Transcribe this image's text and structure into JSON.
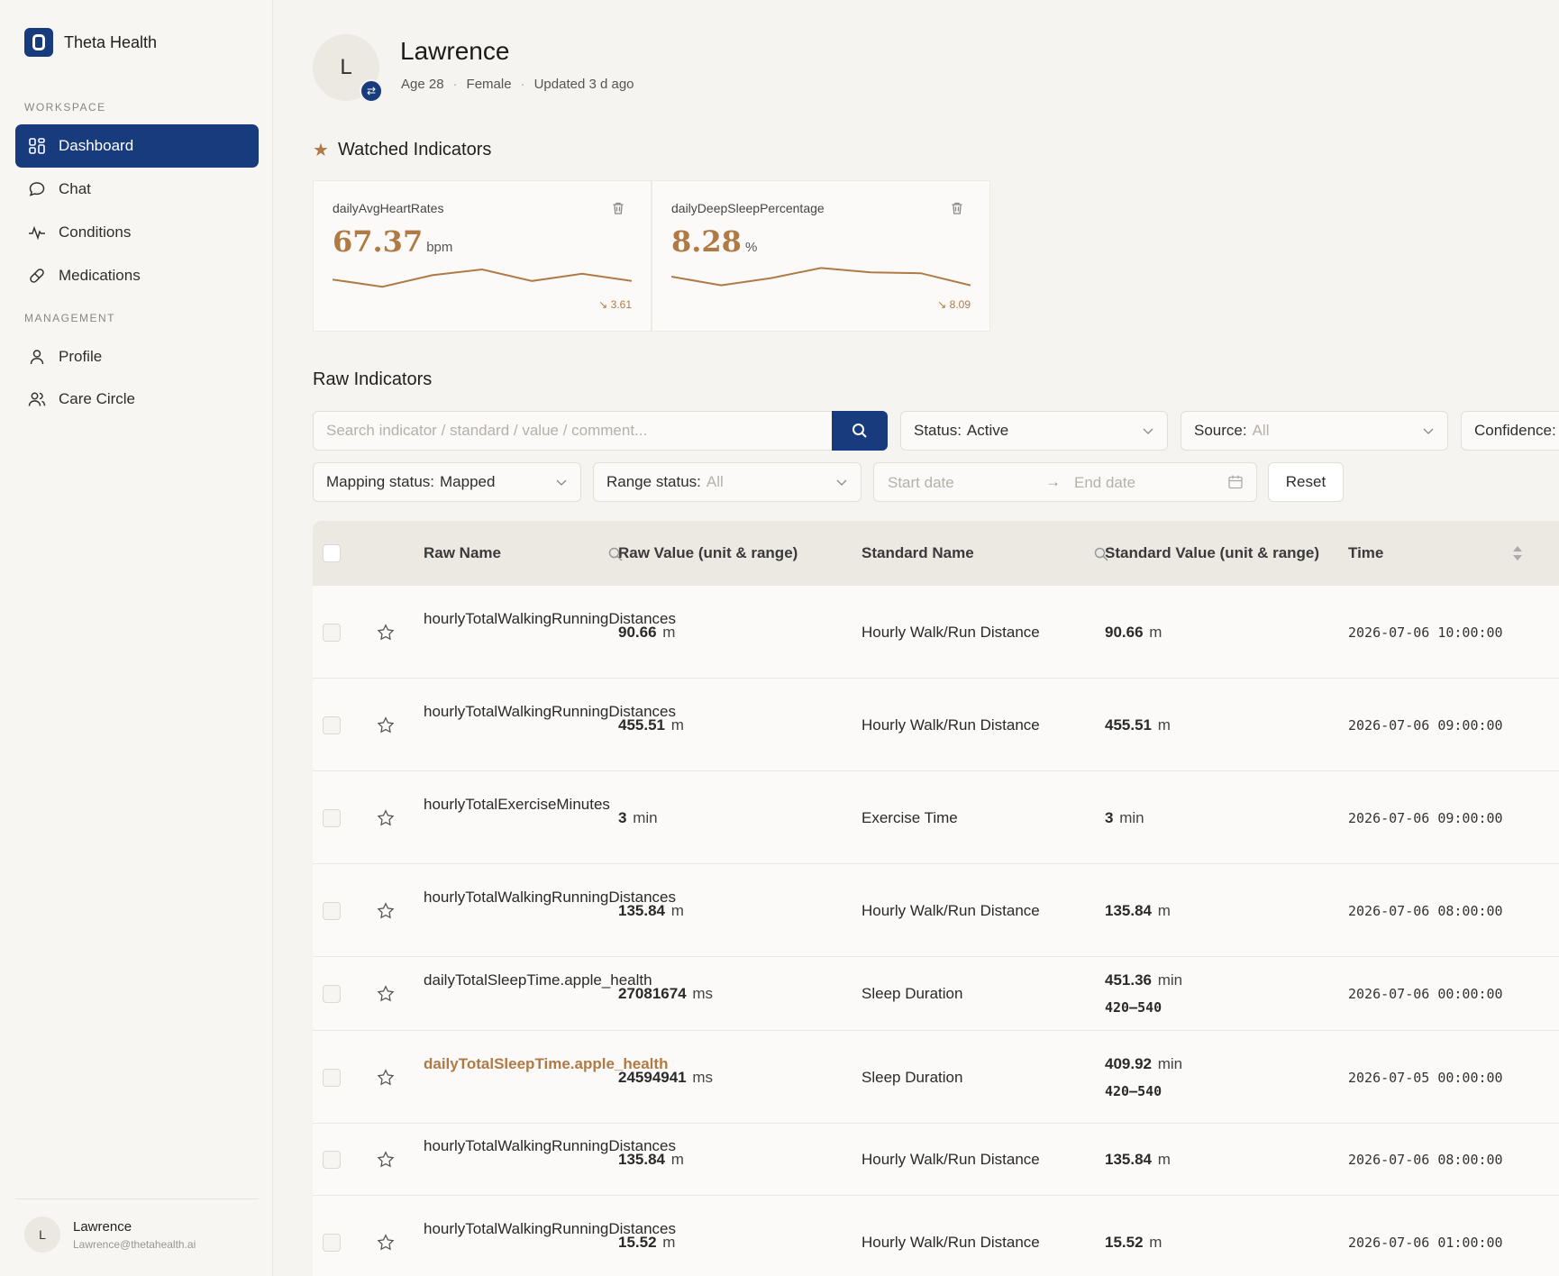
{
  "app": {
    "name": "Theta Health"
  },
  "sidebar": {
    "workspace_label": "WORKSPACE",
    "management_label": "MANAGEMENT",
    "items": [
      {
        "label": "Dashboard",
        "icon": "grid-icon",
        "active": true
      },
      {
        "label": "Chat",
        "icon": "chat-bubble-icon"
      },
      {
        "label": "Conditions",
        "icon": "pulse-icon"
      },
      {
        "label": "Medications",
        "icon": "pill-icon"
      },
      {
        "label": "Profile",
        "icon": "person-icon"
      },
      {
        "label": "Care Circle",
        "icon": "people-icon"
      }
    ],
    "user": {
      "initial": "L",
      "name": "Lawrence",
      "email": "Lawrence@thetahealth.ai"
    }
  },
  "patient": {
    "initial": "L",
    "name": "Lawrence",
    "age": "Age 28",
    "sex": "Female",
    "updated": "Updated 3 d ago"
  },
  "watched": {
    "title": "Watched Indicators",
    "cards": [
      {
        "label": "dailyAvgHeartRates",
        "value": "67.37",
        "unit": "bpm",
        "delta": "↘ 3.61",
        "trend": [
          0.4,
          0.15,
          0.55,
          0.75,
          0.35,
          0.6,
          0.35
        ]
      },
      {
        "label": "dailyDeepSleepPercentage",
        "value": "8.28",
        "unit": "%",
        "delta": "↘ 8.09",
        "trend": [
          0.5,
          0.2,
          0.45,
          0.8,
          0.65,
          0.62,
          0.2
        ]
      }
    ]
  },
  "raw": {
    "title": "Raw Indicators",
    "search_placeholder": "Search indicator / standard / value / comment...",
    "filters": {
      "status_label": "Status:",
      "status_value": "Active",
      "source_label": "Source:",
      "source_value": "All",
      "confidence_label": "Confidence:",
      "mapping_label": "Mapping status:",
      "mapping_value": "Mapped",
      "range_label": "Range status:",
      "range_value": "All",
      "start_placeholder": "Start date",
      "end_placeholder": "End date",
      "reset_label": "Reset"
    },
    "columns": {
      "raw_name": "Raw Name",
      "raw_value": "Raw Value (unit & range)",
      "standard_name": "Standard Name",
      "standard_value": "Standard Value (unit & range)",
      "time": "Time"
    },
    "rows": [
      {
        "raw_name": "hourlyTotalWalkingRunningDistances",
        "raw_value": "90.66",
        "raw_unit": "m",
        "std_name": "Hourly Walk/Run Distance",
        "std_value": "90.66",
        "std_unit": "m",
        "std_range": "",
        "time": "2026-07-06 10:00:00",
        "highlight": false
      },
      {
        "raw_name": "hourlyTotalWalkingRunningDistances",
        "raw_value": "455.51",
        "raw_unit": "m",
        "std_name": "Hourly Walk/Run Distance",
        "std_value": "455.51",
        "std_unit": "m",
        "std_range": "",
        "time": "2026-07-06 09:00:00",
        "highlight": false
      },
      {
        "raw_name": "hourlyTotalExerciseMinutes",
        "raw_value": "3",
        "raw_unit": "min",
        "std_name": "Exercise Time",
        "std_value": "3",
        "std_unit": "min",
        "std_range": "",
        "time": "2026-07-06 09:00:00",
        "highlight": false
      },
      {
        "raw_name": "hourlyTotalWalkingRunningDistances",
        "raw_value": "135.84",
        "raw_unit": "m",
        "std_name": "Hourly Walk/Run Distance",
        "std_value": "135.84",
        "std_unit": "m",
        "std_range": "",
        "time": "2026-07-06 08:00:00",
        "highlight": false
      },
      {
        "raw_name": "dailyTotalSleepTime.apple_health",
        "raw_value": "27081674",
        "raw_unit": "ms",
        "std_name": "Sleep Duration",
        "std_value": "451.36",
        "std_unit": "min",
        "std_range": "420–540",
        "time": "2026-07-06 00:00:00",
        "highlight": false
      },
      {
        "raw_name": "dailyTotalSleepTime.apple_health",
        "raw_value": "24594941",
        "raw_unit": "ms",
        "std_name": "Sleep Duration",
        "std_value": "409.92",
        "std_unit": "min",
        "std_range": "420–540",
        "time": "2026-07-05 00:00:00",
        "highlight": true
      },
      {
        "raw_name": "hourlyTotalWalkingRunningDistances",
        "raw_value": "135.84",
        "raw_unit": "m",
        "std_name": "Hourly Walk/Run Distance",
        "std_value": "135.84",
        "std_unit": "m",
        "std_range": "",
        "time": "2026-07-06 08:00:00",
        "highlight": false
      },
      {
        "raw_name": "hourlyTotalWalkingRunningDistances",
        "raw_value": "15.52",
        "raw_unit": "m",
        "std_name": "Hourly Walk/Run Distance",
        "std_value": "15.52",
        "std_unit": "m",
        "std_range": "",
        "time": "2026-07-06 01:00:00",
        "highlight": false
      }
    ]
  },
  "colors": {
    "brand": "#173b7d",
    "accent": "#b07a45",
    "background": "#f6f4f0"
  }
}
